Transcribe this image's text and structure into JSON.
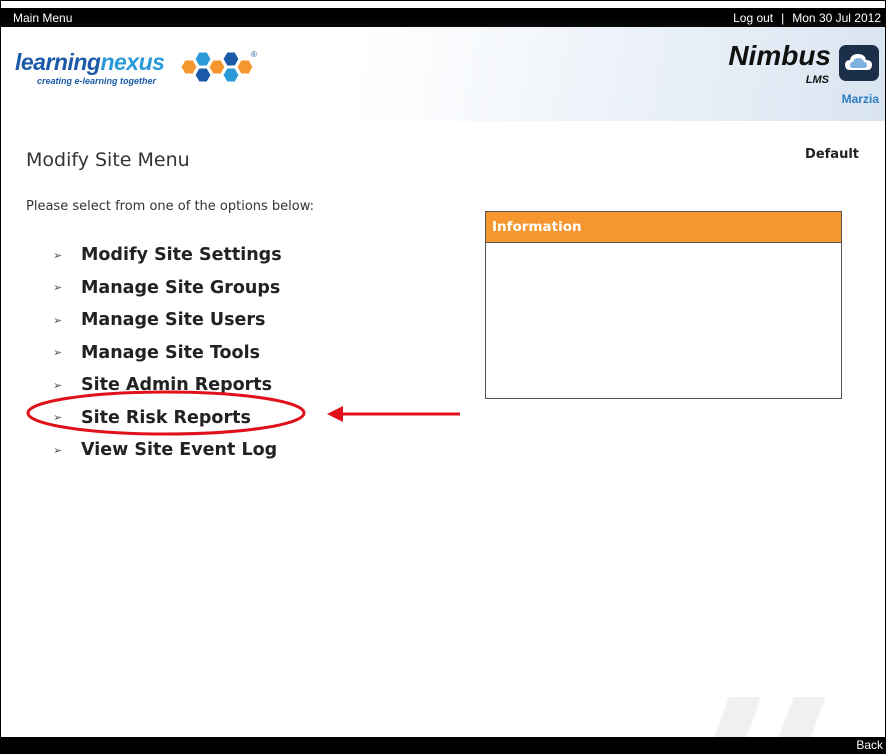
{
  "topbar": {
    "main_menu": "Main Menu",
    "logout": "Log out",
    "separator": "|",
    "date": "Mon 30 Jul 2012"
  },
  "header": {
    "logo_word_a": "learning",
    "logo_word_b": "nexus",
    "logo_tagline": "creating e-learning together",
    "logo_registered": "®",
    "nimbus_title": "Nimbus",
    "nimbus_sub": "LMS",
    "user_name": "Marzia"
  },
  "page": {
    "title": "Modify Site Menu",
    "default_label": "Default",
    "instructions": "Please select from one of the options below:"
  },
  "menu": {
    "arrow_glyph": "➢",
    "items": [
      {
        "label": "Modify Site Settings"
      },
      {
        "label": "Manage Site Groups"
      },
      {
        "label": "Manage Site Users"
      },
      {
        "label": "Manage Site Tools"
      },
      {
        "label": "Site Admin Reports"
      },
      {
        "label": "Site Risk Reports"
      },
      {
        "label": "View Site Event Log"
      }
    ]
  },
  "info_panel": {
    "heading": "Information",
    "heading_color": "#f5962e"
  },
  "annotation": {
    "color": "#e0111b",
    "highlighted_item": "Site Risk Reports"
  },
  "bottombar": {
    "back": "Back"
  }
}
